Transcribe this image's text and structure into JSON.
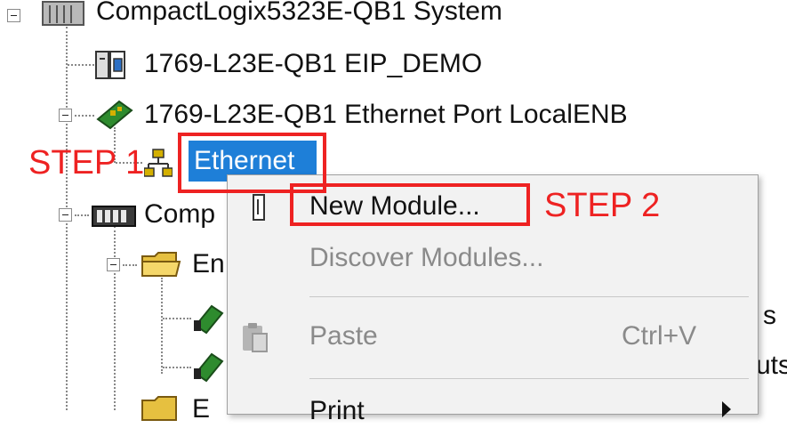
{
  "tree": {
    "root_label": "CompactLogix5323E-QB1 System",
    "controller_label": "1769-L23E-QB1 EIP_DEMO",
    "ethernet_port_label": "1769-L23E-QB1 Ethernet Port LocalENB",
    "ethernet_label": "Ethernet",
    "comp_label": "Comp",
    "en_label": "En",
    "s_label": "s",
    "uts_label": "uts",
    "e_label": "E"
  },
  "annotations": {
    "step1": "STEP 1",
    "step2": "STEP 2",
    "color": "#ee2222"
  },
  "context_menu": {
    "items": [
      {
        "label": "New Module...",
        "enabled": true
      },
      {
        "label": "Discover Modules...",
        "enabled": false
      },
      {
        "label": "Paste",
        "shortcut": "Ctrl+V",
        "enabled": false
      },
      {
        "label": "Print",
        "enabled": true,
        "submenu": true
      }
    ]
  },
  "colors": {
    "selection": "#1e7fd8",
    "menu_bg": "#f2f2f2"
  }
}
